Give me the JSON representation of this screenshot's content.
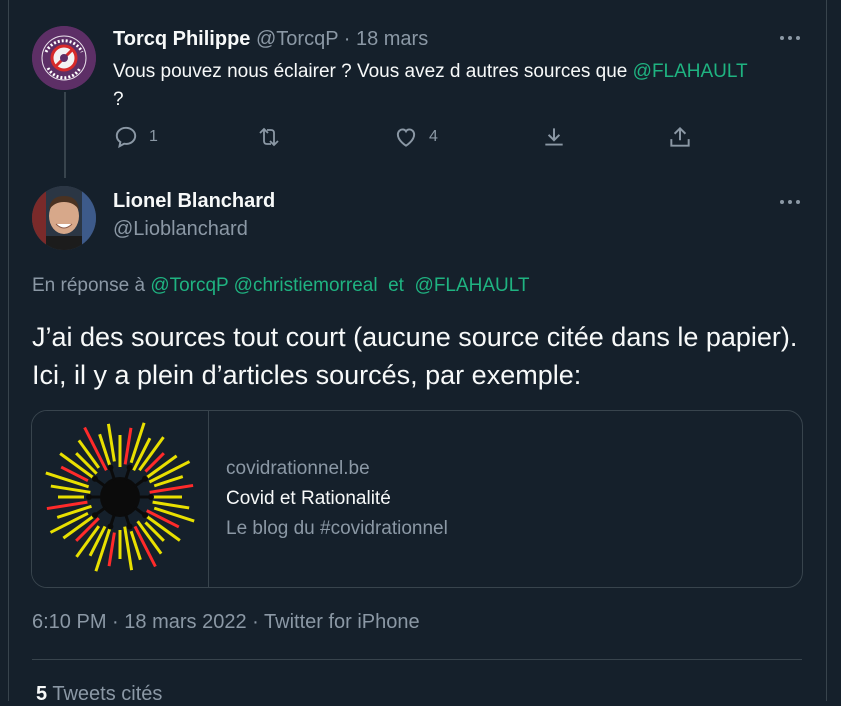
{
  "tweet1": {
    "name": "Torcq Philippe",
    "handle": "@TorcqP",
    "sep": "·",
    "date": "18 mars",
    "text_part1": "Vous pouvez nous éclairer ? Vous avez d autres sources que ",
    "mention": "@FLAHAULT",
    "text_part2": "?",
    "avatar_text_top": "PORTEZ UN MASQUE",
    "avatar_text_bottom": "PAS LE VIRUS !",
    "reply_count": "1",
    "like_count": "4"
  },
  "tweet2": {
    "name": "Lionel Blanchard",
    "handle": "@Lioblanchard",
    "reply_prefix": "En réponse à",
    "reply_mention1": "@TorcqP",
    "reply_mention2": "@christiemorreal",
    "reply_and": "et",
    "reply_mention3": "@FLAHAULT",
    "text": "J’ai des sources tout court (aucune source citée dans le papier). Ici, il y a plein d’articles sourcés, par exemple:",
    "card": {
      "domain": "covidrationnel.be",
      "title": "Covid et Rationalité",
      "description": "Le blog du #covidrationnel"
    },
    "time": "6:10 PM",
    "sep": "·",
    "date": "18 mars 2022",
    "client": "Twitter for iPhone",
    "quote_count": "5",
    "quote_label": "Tweets cités"
  },
  "more_label": "•••",
  "colors": {
    "background": "#15202b",
    "text": "#f7f9f9",
    "muted": "#8b98a5",
    "link": "#1fb381",
    "border": "#38444d"
  }
}
